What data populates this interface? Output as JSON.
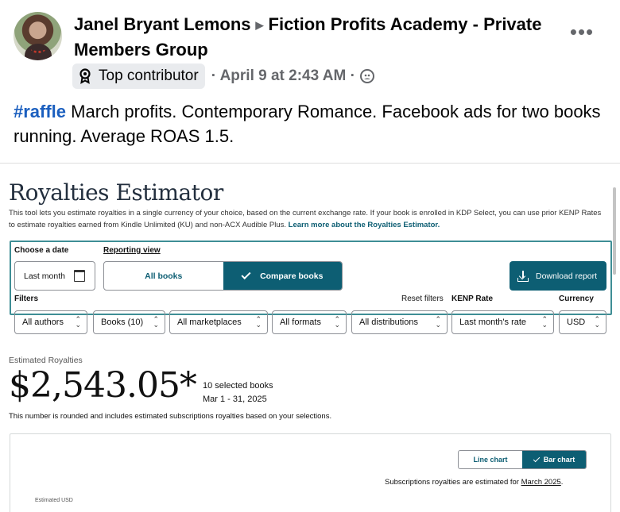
{
  "post": {
    "author": "Janel Bryant Lemons",
    "group": "Fiction Profits Academy - Private Members Group",
    "badge": "Top contributor",
    "timestamp": "· April 9 at 2:43 AM ·",
    "hashtag": "#raffle",
    "body": " March profits. Contemporary Romance. Facebook ads for two books running. Average ROAS 1.5."
  },
  "estimator": {
    "title": "Royalties Estimator",
    "description": "This tool lets you estimate royalties in a single currency of your choice, based on the current exchange rate. If your book is enrolled in KDP Select, you can use prior KENP Rates to estimate royalties earned from Kindle Unlimited (KU) and non-ACX Audible Plus. ",
    "learn_more": "Learn more about the Royalties Estimator.",
    "choose_date_label": "Choose a date",
    "date_value": "Last month",
    "reporting_view_label": "Reporting view",
    "view_options": [
      "All books",
      "Compare books"
    ],
    "download_label": "Download report",
    "filters_label": "Filters",
    "reset_filters": "Reset filters",
    "kenp_label": "KENP Rate",
    "currency_label": "Currency",
    "filters": {
      "authors": "All authors",
      "books": "Books (10)",
      "marketplaces": "All marketplaces",
      "formats": "All formats",
      "distributions": "All distributions",
      "kenp": "Last month's rate",
      "currency": "USD"
    },
    "estimated_label": "Estimated Royalties",
    "estimated_value": "$2,543.05*",
    "selected_books": "10 selected books",
    "date_range": "Mar 1 - 31, 2025",
    "rounding_note": "This number is rounded and includes estimated subscriptions royalties based on your selections.",
    "chart_options": [
      "Line chart",
      "Bar chart"
    ],
    "subscriptions_note": "Subscriptions royalties are estimated for ",
    "subscriptions_month": "March 2025",
    "subscriptions_end": ".",
    "y_axis_label": "Estimated USD"
  },
  "colors": {
    "accent": "#0d5e73",
    "filter_border": "#3e8e95",
    "hashtag": "#1b5fbf",
    "meta": "#65676b"
  }
}
